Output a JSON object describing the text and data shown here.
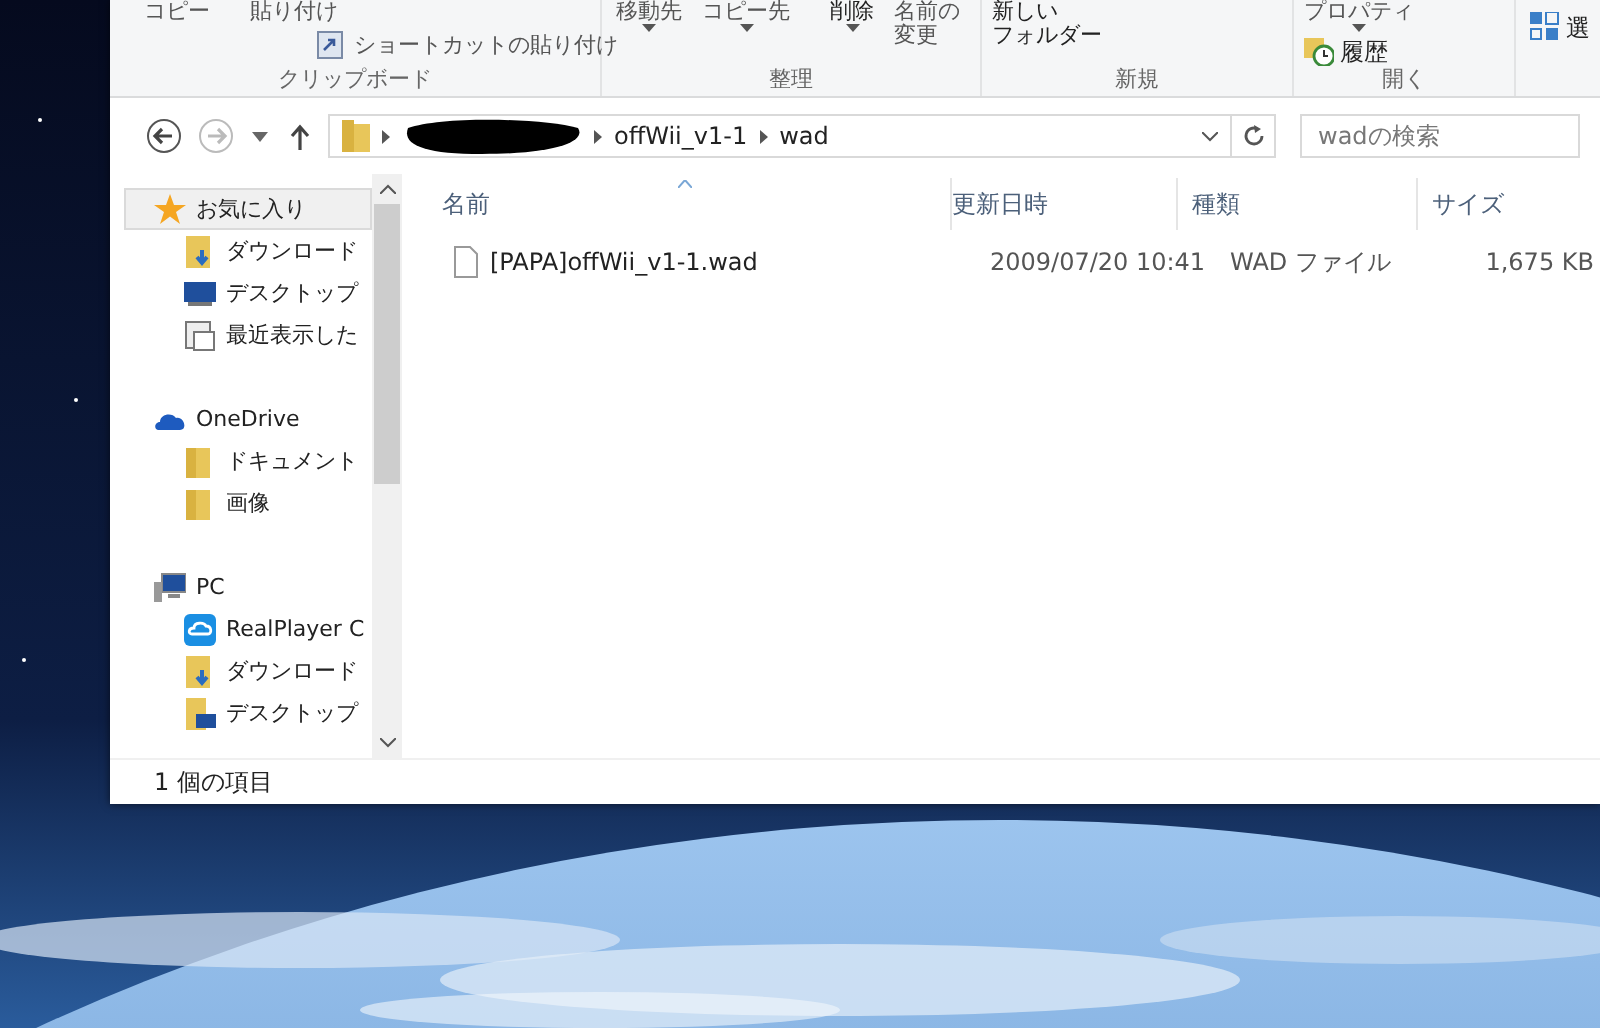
{
  "ribbon": {
    "groups": [
      {
        "label": "クリップボード",
        "items": [
          {
            "kind": "button",
            "lines": [
              "コピー"
            ],
            "dropdown": false
          },
          {
            "kind": "button",
            "lines": [
              "貼り付け"
            ],
            "dropdown": false
          },
          {
            "kind": "paste-shortcut",
            "lines": [
              "ショートカットの貼り付け"
            ],
            "dropdown": false
          }
        ]
      },
      {
        "label": "整理",
        "items": [
          {
            "kind": "button",
            "lines": [
              "移動先"
            ],
            "dropdown": true
          },
          {
            "kind": "button",
            "lines": [
              "コピー先"
            ],
            "dropdown": true
          },
          {
            "kind": "button",
            "lines": [
              "削除"
            ],
            "dropdown": true
          },
          {
            "kind": "button",
            "lines": [
              "名前の",
              "変更"
            ],
            "dropdown": false
          }
        ]
      },
      {
        "label": "新規",
        "items": [
          {
            "kind": "button",
            "lines": [
              "新しい",
              "フォルダー"
            ],
            "dropdown": false
          }
        ]
      },
      {
        "label": "開く",
        "items": [
          {
            "kind": "button",
            "lines": [
              "プロパティ"
            ],
            "dropdown": true
          },
          {
            "kind": "history",
            "lines": [
              "履歴"
            ],
            "dropdown": false
          }
        ]
      },
      {
        "items": [
          {
            "kind": "select",
            "lines": [
              "選"
            ],
            "dropdown": false
          }
        ]
      }
    ]
  },
  "address": {
    "path": [
      "offWii_v1-1",
      "wad"
    ],
    "redacted": true
  },
  "search": {
    "placeholder": "wadの検索"
  },
  "nav": [
    {
      "label": "お気に入り",
      "kind": "favorites",
      "selected": true,
      "children": [
        {
          "label": "ダウンロード",
          "kind": "download",
          "selected": false
        },
        {
          "label": "デスクトップ",
          "kind": "desktop",
          "selected": false
        },
        {
          "label": "最近表示した",
          "kind": "recent",
          "selected": false
        }
      ]
    },
    {
      "label": "OneDrive",
      "kind": "cloud",
      "selected": false,
      "children": [
        {
          "label": "ドキュメント",
          "kind": "folder",
          "selected": false
        },
        {
          "label": "画像",
          "kind": "folder",
          "selected": false
        }
      ]
    },
    {
      "label": "PC",
      "kind": "pc",
      "selected": false,
      "children": [
        {
          "label": "RealPlayer C",
          "kind": "realplayer",
          "selected": false
        },
        {
          "label": "ダウンロード",
          "kind": "download",
          "selected": false
        },
        {
          "label": "デスクトップ",
          "kind": "desktop-folder",
          "selected": false
        }
      ]
    }
  ],
  "table": {
    "columns": [
      "名前",
      "更新日時",
      "種類",
      "サイズ"
    ],
    "rows": [
      {
        "name": "[PAPA]offWii_v1-1.wad",
        "modified": "2009/07/20 10:41",
        "type": "WAD ファイル",
        "size": "1,675 KB",
        "selected": false
      }
    ]
  },
  "status_bar": {
    "count": "1 個の項目"
  }
}
